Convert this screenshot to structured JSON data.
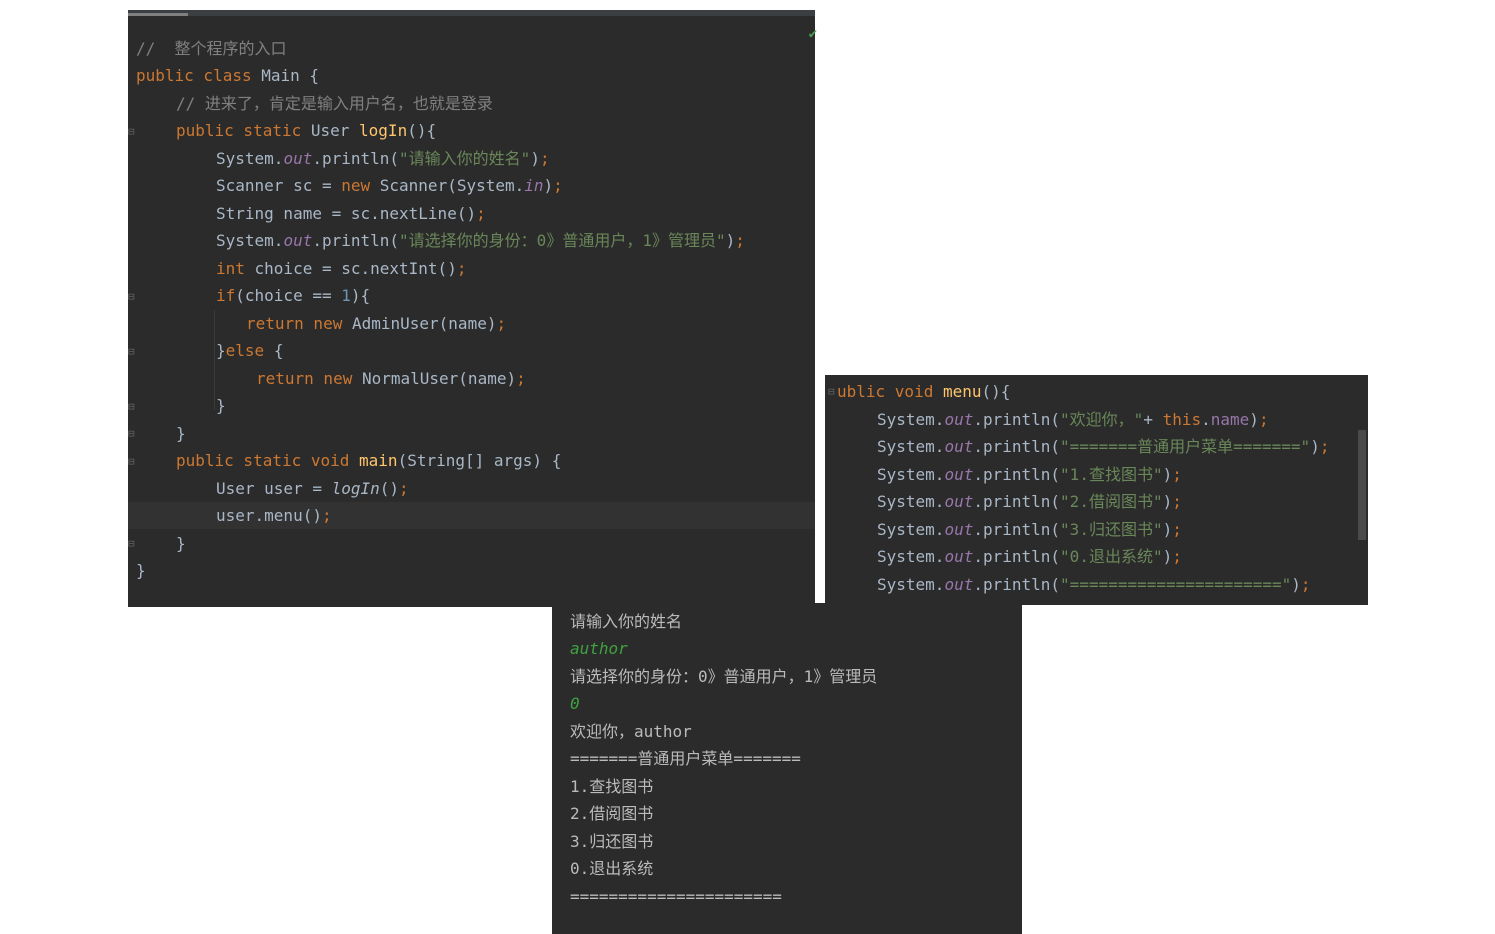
{
  "editor1": {
    "l1": {
      "comment": "//  整个程序的入口"
    },
    "l2": {
      "kw": "public class ",
      "cls": "Main {"
    },
    "l3": {
      "comment": "// 进来了，肯定是输入用户名，也就是登录"
    },
    "l4": {
      "kw": "public static ",
      "type": "User ",
      "fn": "logIn",
      "rest": "(){"
    },
    "l5": {
      "a": "System.",
      "f": "out",
      "b": ".println(",
      "s": "\"请输入你的姓名\"",
      "c": ")",
      "semi": ";"
    },
    "l6": {
      "a": "Scanner sc = ",
      "kw": "new ",
      "b": "Scanner(System.",
      "f": "in",
      "c": ")",
      "semi": ";"
    },
    "l7": {
      "a": "String name = sc.nextLine()",
      "semi": ";"
    },
    "l8": {
      "a": "System.",
      "f": "out",
      "b": ".println(",
      "s": "\"请选择你的身份：0》普通用户，1》管理员\"",
      "c": ")",
      "semi": ";"
    },
    "l9": {
      "kw": "int ",
      "a": "choice = sc.nextInt()",
      "semi": ";"
    },
    "l10": {
      "kw": "if",
      "a": "(choice == ",
      "num": "1",
      "b": "){"
    },
    "l11": {
      "kw": "return new ",
      "a": "AdminUser(name)",
      "semi": ";"
    },
    "l12": {
      "a": "}",
      "kw": "else ",
      "b": "{"
    },
    "l13": {
      "kw": "return new ",
      "a": "NormalUser(name)",
      "semi": ";"
    },
    "l14": {
      "a": "}"
    },
    "l15": {
      "a": "}"
    },
    "l16": {
      "kw": "public static void ",
      "fn": "main",
      "rest": "(String[] args) {"
    },
    "l17": {
      "a": "User user = ",
      "it": "logIn",
      "b": "()",
      "semi": ";"
    },
    "l18": {
      "a": "user.menu()",
      "semi": ";"
    },
    "l19": {
      "a": "}"
    },
    "l20": {
      "a": "}"
    }
  },
  "editor2": {
    "l1": {
      "kw": "ublic void ",
      "fn": "menu",
      "rest": "(){"
    },
    "l2": {
      "a": "System.",
      "f": "out",
      "b": ".println(",
      "s": "\"欢迎你，\"",
      "c": "+ ",
      "kw": "this",
      "d": ".",
      "fld": "name",
      "e": ")",
      "semi": ";"
    },
    "l3": {
      "a": "System.",
      "f": "out",
      "b": ".println(",
      "s": "\"=======普通用户菜单=======\"",
      "c": ")",
      "semi": ";"
    },
    "l4": {
      "a": "System.",
      "f": "out",
      "b": ".println(",
      "s": "\"1.查找图书\"",
      "c": ")",
      "semi": ";"
    },
    "l5": {
      "a": "System.",
      "f": "out",
      "b": ".println(",
      "s": "\"2.借阅图书\"",
      "c": ")",
      "semi": ";"
    },
    "l6": {
      "a": "System.",
      "f": "out",
      "b": ".println(",
      "s": "\"3.归还图书\"",
      "c": ")",
      "semi": ";"
    },
    "l7": {
      "a": "System.",
      "f": "out",
      "b": ".println(",
      "s": "\"0.退出系统\"",
      "c": ")",
      "semi": ";"
    },
    "l8": {
      "a": "System.",
      "f": "out",
      "b": ".println(",
      "s": "\"======================\"",
      "c": ")",
      "semi": ";"
    }
  },
  "console": {
    "lines": [
      {
        "text": "请输入你的姓名",
        "input": false
      },
      {
        "text": "author",
        "input": true
      },
      {
        "text": "请选择你的身份：0》普通用户，1》管理员",
        "input": false
      },
      {
        "text": "0",
        "input": true
      },
      {
        "text": "欢迎你，author",
        "input": false
      },
      {
        "text": "=======普通用户菜单=======",
        "input": false
      },
      {
        "text": "1.查找图书",
        "input": false
      },
      {
        "text": "2.借阅图书",
        "input": false
      },
      {
        "text": "3.归还图书",
        "input": false
      },
      {
        "text": "0.退出系统",
        "input": false
      },
      {
        "text": "======================",
        "input": false
      }
    ]
  },
  "icons": {
    "check": "✔",
    "fold": "⊟"
  },
  "colors": {
    "background": "#2b2b2b",
    "keyword": "#cc7832",
    "string": "#6a8759",
    "method": "#ffc66d",
    "field": "#9876aa",
    "comment": "#808080",
    "console_input": "#3fa23f"
  }
}
